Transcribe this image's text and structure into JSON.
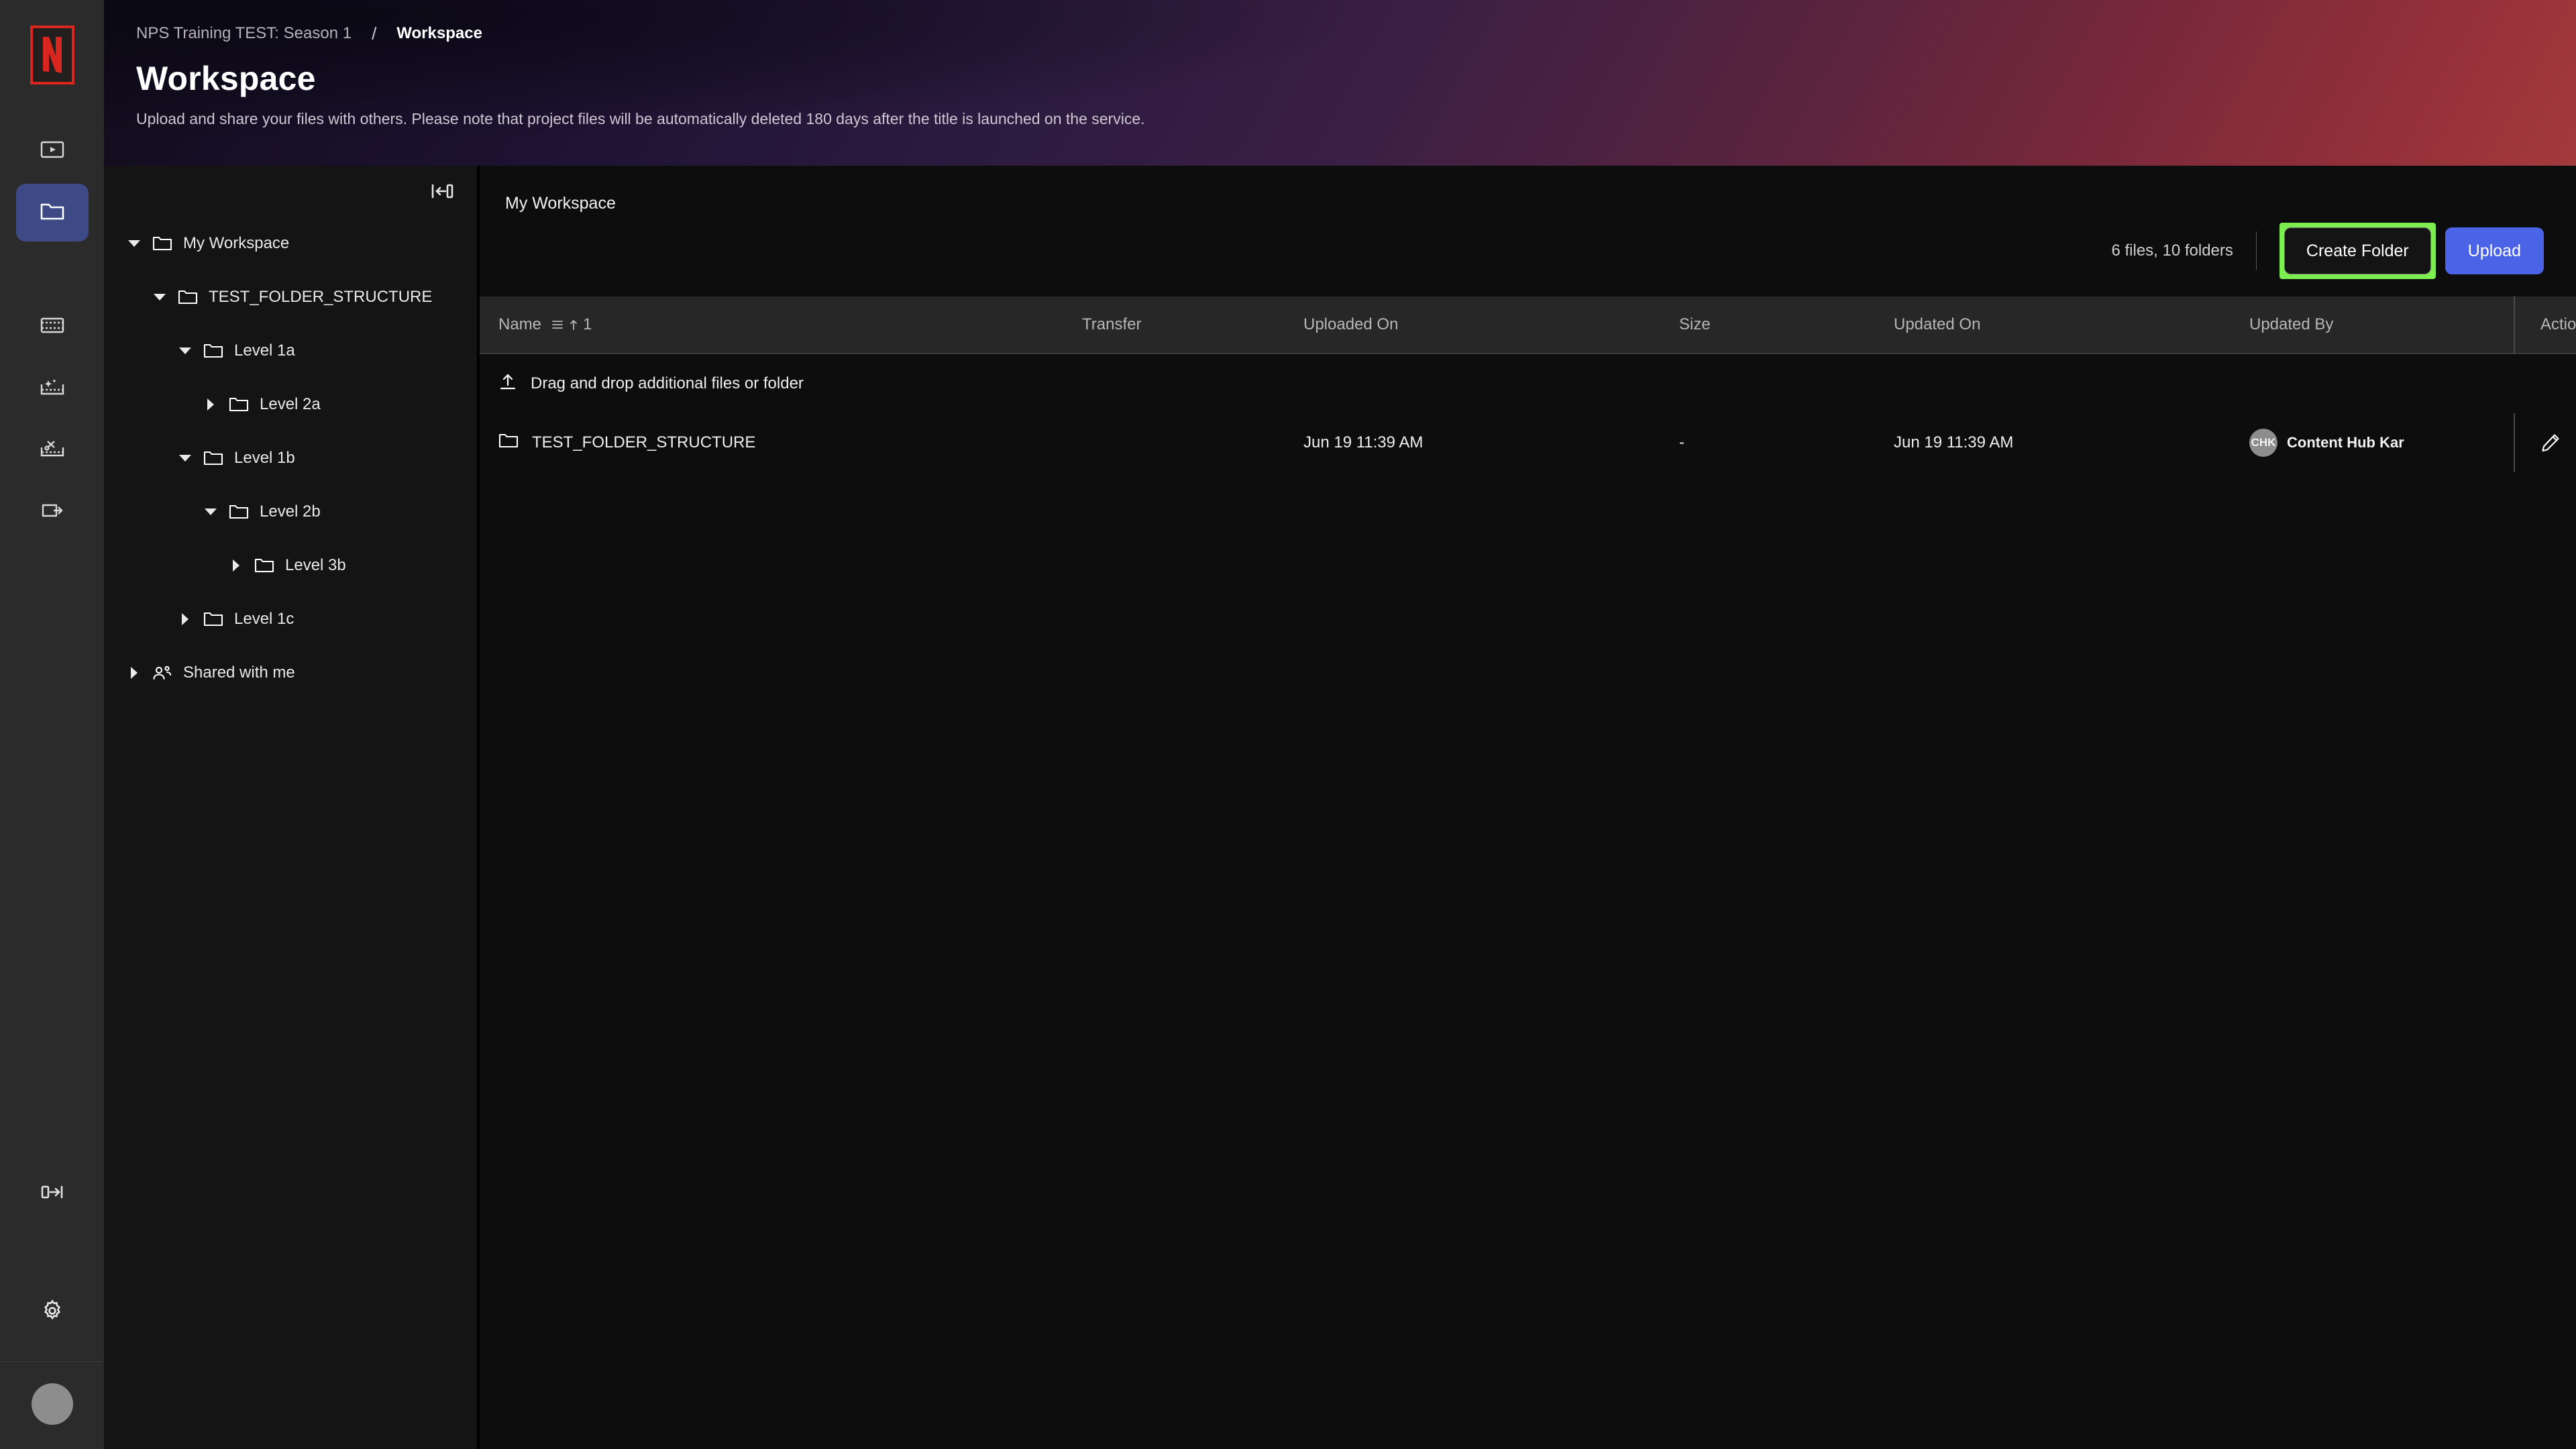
{
  "rail": {
    "logo_name": "netflix-logo",
    "items": [
      {
        "name": "player-icon",
        "label": "Player"
      },
      {
        "name": "folder-icon",
        "label": "Workspace",
        "active": true
      },
      {
        "name": "film-strip-icon",
        "label": "Media"
      },
      {
        "name": "film-strip-sparkle-icon",
        "label": "Enhance"
      },
      {
        "name": "film-strip-scissors-icon",
        "label": "Edit"
      },
      {
        "name": "transfer-arrow-icon",
        "label": "Transfer"
      }
    ],
    "bottom": [
      {
        "name": "expand-panel-icon",
        "label": "Expand"
      },
      {
        "name": "gear-icon",
        "label": "Settings"
      },
      {
        "name": "avatar",
        "label": ""
      }
    ]
  },
  "banner": {
    "breadcrumb_parent": "NPS Training TEST: Season 1",
    "breadcrumb_separator": "/",
    "breadcrumb_current": "Workspace",
    "title": "Workspace",
    "subtitle": "Upload and share your files with others. Please note that project files will be automatically deleted 180 days after the title is launched on the service."
  },
  "tree": {
    "collapse_icon": "collapse-panel-icon",
    "items": [
      {
        "label": "My Workspace",
        "depth": 0,
        "state": "expanded",
        "icon": "folder-icon"
      },
      {
        "label": "TEST_FOLDER_STRUCTURE",
        "depth": 1,
        "state": "expanded",
        "icon": "folder-icon"
      },
      {
        "label": "Level 1a",
        "depth": 2,
        "state": "expanded",
        "icon": "folder-icon"
      },
      {
        "label": "Level 2a",
        "depth": 3,
        "state": "collapsed",
        "icon": "folder-icon"
      },
      {
        "label": "Level 1b",
        "depth": 2,
        "state": "expanded",
        "icon": "folder-icon"
      },
      {
        "label": "Level 2b",
        "depth": 3,
        "state": "expanded",
        "icon": "folder-icon"
      },
      {
        "label": "Level 3b",
        "depth": 4,
        "state": "collapsed",
        "icon": "folder-icon"
      },
      {
        "label": "Level 1c",
        "depth": 2,
        "state": "collapsed",
        "icon": "folder-icon"
      },
      {
        "label": "Shared with me",
        "depth": 0,
        "state": "collapsed",
        "icon": "shared-users-icon"
      }
    ]
  },
  "main": {
    "title": "My Workspace",
    "counts": "6 files, 10 folders",
    "create_folder_label": "Create Folder",
    "upload_label": "Upload",
    "highlight_color": "#7cee4f",
    "upload_color": "#4a63e7",
    "dropzone_label": "Drag and drop additional files or folder",
    "columns": {
      "name": "Name",
      "sort_order": "1",
      "transfer": "Transfer",
      "uploaded_on": "Uploaded On",
      "size": "Size",
      "updated_on": "Updated On",
      "updated_by": "Updated By",
      "action": "Action"
    },
    "rows": [
      {
        "icon": "folder-icon",
        "name": "TEST_FOLDER_STRUCTURE",
        "transfer": "",
        "uploaded_on": "Jun 19 11:39 AM",
        "size": "-",
        "updated_on": "Jun 19 11:39 AM",
        "updated_by_initials": "CHK",
        "updated_by_name": "Content Hub Kar",
        "actions": [
          "edit-pencil-icon",
          "share-arrow-icon",
          "download-icon",
          "more-options-icon"
        ]
      }
    ]
  }
}
